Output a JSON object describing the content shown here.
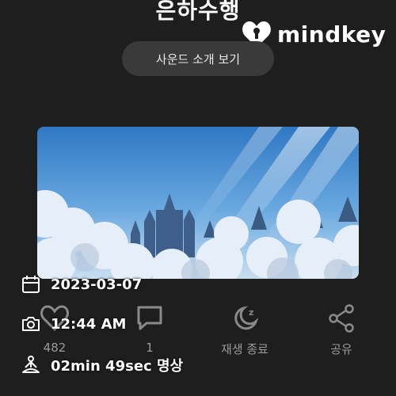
{
  "header": {
    "title": "은하수행",
    "brand": "mindkey"
  },
  "sound_intro_button": "사운드 소개 보기",
  "actions": [
    {
      "icon": "heart-icon",
      "label": "482"
    },
    {
      "icon": "comment-icon",
      "label": "1"
    },
    {
      "icon": "sleep-timer-icon",
      "label": "재생 종료"
    },
    {
      "icon": "share-icon",
      "label": "공유"
    }
  ],
  "meta": {
    "date": "2023-03-07",
    "time": "12:44 AM",
    "duration": "02min 49sec 명상"
  },
  "colors": {
    "background": "#1e1e1e",
    "button": "#3a3a3a",
    "muted": "#9a9a9a"
  }
}
